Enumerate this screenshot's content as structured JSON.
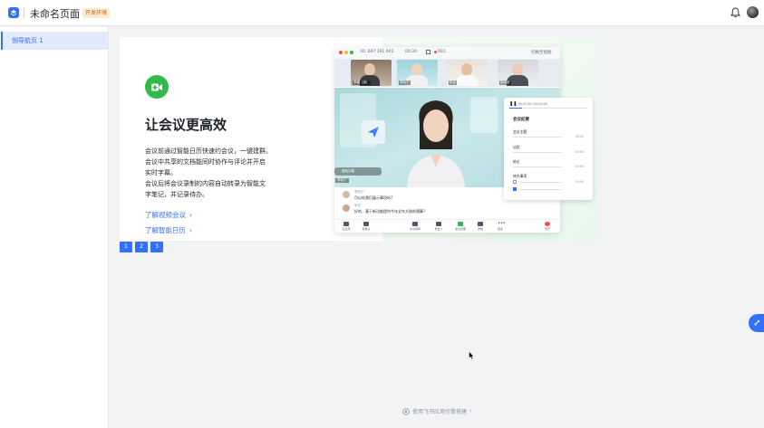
{
  "header": {
    "title": "未命名页面",
    "env_badge": "开发环境"
  },
  "sidebar": {
    "items": [
      {
        "label": "侧导航页 1",
        "active": true
      }
    ]
  },
  "banner": {
    "headline": "让会议更高效",
    "description": [
      "会议前通过智能日历快速约会议，一键建群。",
      "会议中共享的文档能同时协作与评论并开启",
      "实时字幕。",
      "会议后将会议录制的内容自动转录为智能文",
      "字笔记，并记录待办。"
    ],
    "links": [
      {
        "label": "了解视频会议"
      },
      {
        "label": "了解智能日历"
      }
    ]
  },
  "pagination": {
    "pages": [
      "1",
      "2",
      "3"
    ],
    "active": "1"
  },
  "meeting_mock": {
    "meeting_id": "ID: 697 391 042",
    "timer": "00:34",
    "rec": "REC",
    "layout_btn": "切换至视图",
    "participants": [
      {
        "name": "李曦（我）"
      },
      {
        "name": "李晓宁"
      },
      {
        "name": "张佳"
      },
      {
        "name": "张晓妍"
      }
    ],
    "subtitle_placeholder": "搜索字幕",
    "speaker_tag": "李晓宁",
    "chat": [
      {
        "name": "李晓宁",
        "text": "可以给我们展示事项吗?"
      },
      {
        "name": "张佳",
        "text": "好的，基于新功能提供今年全年大致的预算?"
      }
    ],
    "toolbar": [
      "麦克风",
      "摄像头",
      "",
      "",
      "",
      "",
      "",
      "",
      "共享屏幕",
      "参会人",
      "",
      "",
      "",
      "",
      "",
      "会议纪要",
      "",
      "录制",
      "",
      "更多",
      "",
      "",
      "",
      "",
      "离开"
    ],
    "record_panel": {
      "title": "会议纪要",
      "timecode": "00:07:00 / 00:52:00",
      "sections": [
        {
          "label": "会议主题",
          "time": "00:00"
        },
        {
          "label": "议程",
          "time": "00:00"
        },
        {
          "label": "结论",
          "time": "00:00"
        },
        {
          "label": "待办事项",
          "time": "00:00"
        }
      ]
    }
  },
  "footer": {
    "text": "使用飞书应用引擎搭建"
  },
  "colors": {
    "accent": "#3370ff",
    "green": "#34b94b",
    "badge_bg": "#fdebd4",
    "badge_text": "#c0620a"
  }
}
